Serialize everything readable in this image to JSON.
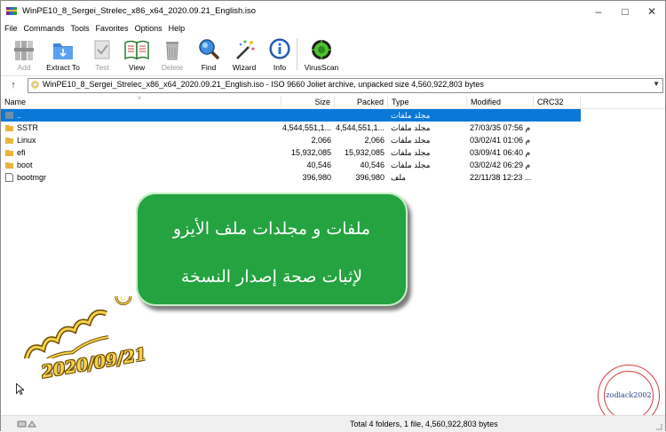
{
  "window": {
    "title": "WinPE10_8_Sergei_Strelec_x86_x64_2020.09.21_English.iso"
  },
  "menu": [
    "File",
    "Commands",
    "Tools",
    "Favorites",
    "Options",
    "Help"
  ],
  "toolbar": {
    "add": "Add",
    "extract": "Extract To",
    "test": "Test",
    "view": "View",
    "delete": "Delete",
    "find": "Find",
    "wizard": "Wizard",
    "info": "Info",
    "virusscan": "VirusScan"
  },
  "address": {
    "text": "WinPE10_8_Sergei_Strelec_x86_x64_2020.09.21_English.iso - ISO 9660 Joliet archive, unpacked size 4,560,922,803 bytes"
  },
  "columns": {
    "name": "Name",
    "size": "Size",
    "packed": "Packed",
    "type": "Type",
    "modified": "Modified",
    "crc": "CRC32"
  },
  "files": [
    {
      "name": "..",
      "size": "",
      "packed": "",
      "type": "مجلد ملفات",
      "modified": "",
      "kind": "parent",
      "selected": true
    },
    {
      "name": "SSTR",
      "size": "4,544,551,1...",
      "packed": "4,544,551,1...",
      "type": "مجلد ملفات",
      "modified": "27/03/35 07:56 م",
      "kind": "folder",
      "selected": false
    },
    {
      "name": "Linux",
      "size": "2,066",
      "packed": "2,066",
      "type": "مجلد ملفات",
      "modified": "03/02/41 01:06 م",
      "kind": "folder",
      "selected": false
    },
    {
      "name": "efi",
      "size": "15,932,085",
      "packed": "15,932,085",
      "type": "مجلد ملفات",
      "modified": "03/09/41 06:40 م",
      "kind": "folder",
      "selected": false
    },
    {
      "name": "boot",
      "size": "40,546",
      "packed": "40,546",
      "type": "مجلد ملفات",
      "modified": "03/02/42 06:29 م",
      "kind": "folder",
      "selected": false
    },
    {
      "name": "bootmgr",
      "size": "396,980",
      "packed": "396,980",
      "type": "ملف",
      "modified": "22/11/38 12:23 ...",
      "kind": "file",
      "selected": false
    }
  ],
  "status": {
    "text": "Total 4 folders, 1 file, 4,560,922,803 bytes"
  },
  "overlay": {
    "line1": "ملفات و مجلدات ملف الأيزو",
    "line2": "لإثبات صحة إصدار النسخة"
  },
  "watermark": {
    "date": "2020/09/21",
    "stamp": "zodiack2002"
  },
  "colors": {
    "selection": "#0a78d7",
    "callout": "#24a340"
  }
}
